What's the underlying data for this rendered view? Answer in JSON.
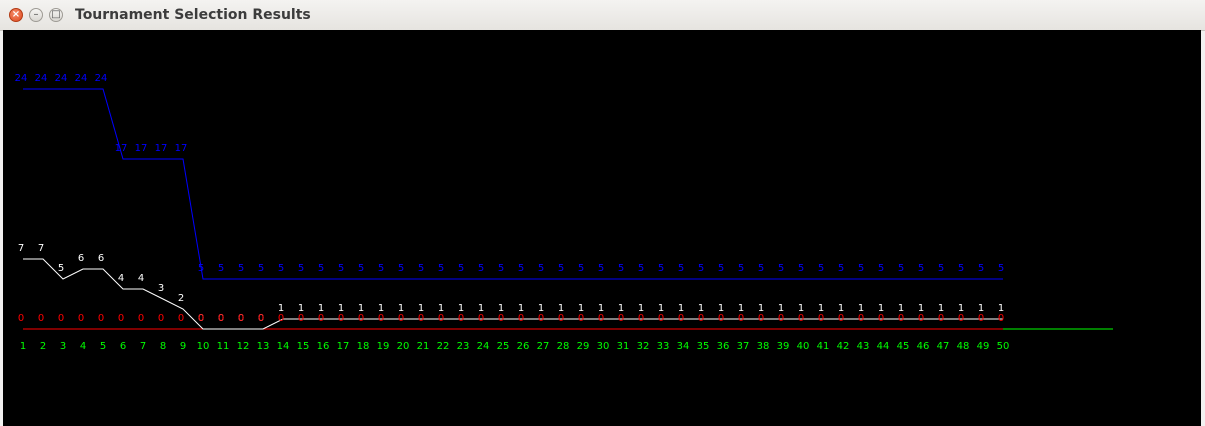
{
  "window": {
    "title": "Tournament Selection Results"
  },
  "controls": {
    "close_glyph": "×",
    "minimize_glyph": "–",
    "maximize_glyph": "□"
  },
  "colors": {
    "window_bg": "#000000",
    "axis": "#00ff00",
    "blue_series": "#0000ff",
    "white_series": "#ffffff",
    "red_series": "#ff0000"
  },
  "chart_data": {
    "type": "line",
    "title": "",
    "xlabel": "",
    "ylabel": "",
    "x": [
      1,
      2,
      3,
      4,
      5,
      6,
      7,
      8,
      9,
      10,
      11,
      12,
      13,
      14,
      15,
      16,
      17,
      18,
      19,
      20,
      21,
      22,
      23,
      24,
      25,
      26,
      27,
      28,
      29,
      30,
      31,
      32,
      33,
      34,
      35,
      36,
      37,
      38,
      39,
      40,
      41,
      42,
      43,
      44,
      45,
      46,
      47,
      48,
      49,
      50
    ],
    "ylim": [
      0,
      24
    ],
    "grid": false,
    "legend": "none",
    "series": [
      {
        "color": "#0000ff",
        "values": [
          24,
          24,
          24,
          24,
          24,
          17,
          17,
          17,
          17,
          5,
          5,
          5,
          5,
          5,
          5,
          5,
          5,
          5,
          5,
          5,
          5,
          5,
          5,
          5,
          5,
          5,
          5,
          5,
          5,
          5,
          5,
          5,
          5,
          5,
          5,
          5,
          5,
          5,
          5,
          5,
          5,
          5,
          5,
          5,
          5,
          5,
          5,
          5,
          5,
          5
        ]
      },
      {
        "color": "#ffffff",
        "values": [
          7,
          7,
          5,
          6,
          6,
          4,
          4,
          3,
          2,
          0,
          0,
          0,
          0,
          1,
          1,
          1,
          1,
          1,
          1,
          1,
          1,
          1,
          1,
          1,
          1,
          1,
          1,
          1,
          1,
          1,
          1,
          1,
          1,
          1,
          1,
          1,
          1,
          1,
          1,
          1,
          1,
          1,
          1,
          1,
          1,
          1,
          1,
          1,
          1,
          1
        ]
      },
      {
        "color": "#ff0000",
        "values": [
          0,
          0,
          0,
          0,
          0,
          0,
          0,
          0,
          0,
          0,
          0,
          0,
          0,
          0,
          0,
          0,
          0,
          0,
          0,
          0,
          0,
          0,
          0,
          0,
          0,
          0,
          0,
          0,
          0,
          0,
          0,
          0,
          0,
          0,
          0,
          0,
          0,
          0,
          0,
          0,
          0,
          0,
          0,
          0,
          0,
          0,
          0,
          0,
          0,
          0
        ]
      }
    ]
  }
}
